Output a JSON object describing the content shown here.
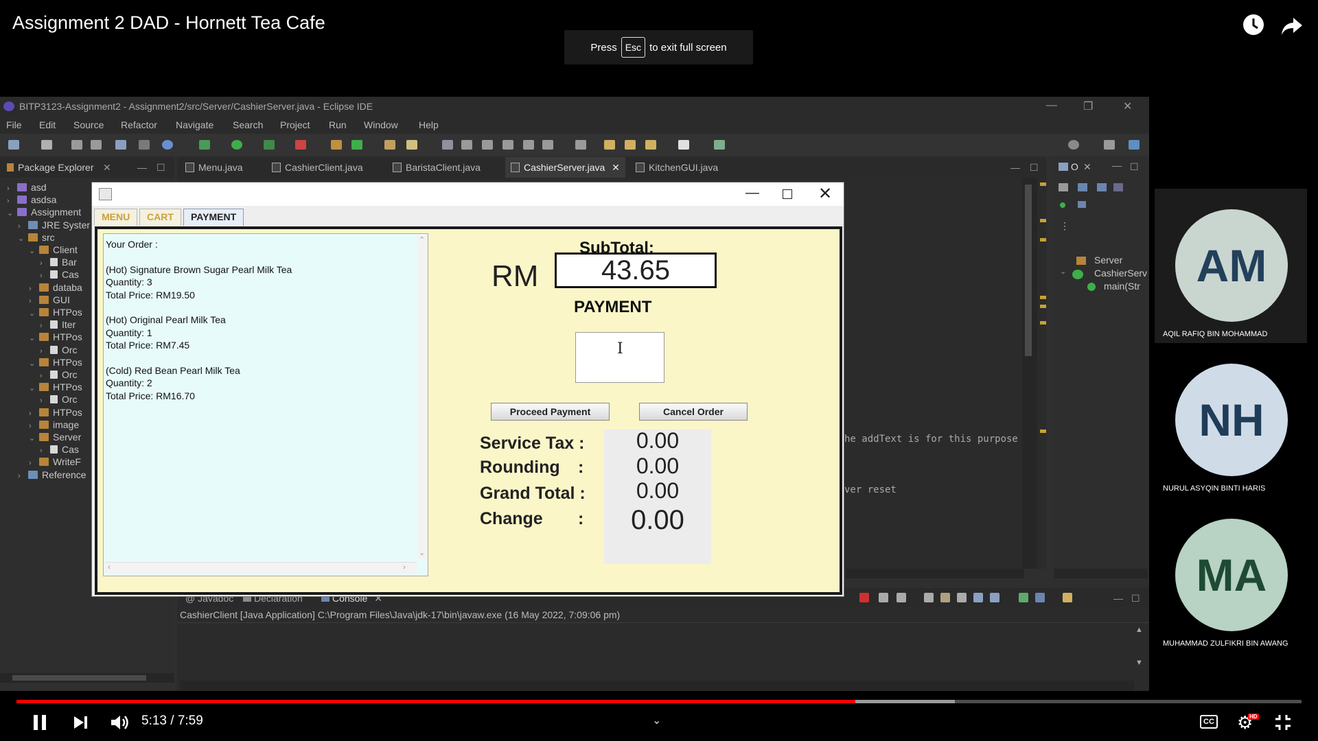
{
  "video": {
    "title": "Assignment 2 DAD - Hornett Tea Cafe",
    "esc_press": "Press",
    "esc_key": "Esc",
    "esc_suffix": "to exit full screen",
    "time": "5:13 / 7:59",
    "progress_fraction": 0.653,
    "buffered_fraction": 0.73,
    "cc_label": "CC",
    "hd_badge": "HD"
  },
  "eclipse": {
    "window_title": "BITP3123-Assignment2 - Assignment2/src/Server/CashierServer.java - Eclipse IDE",
    "menu": [
      "File",
      "Edit",
      "Source",
      "Refactor",
      "Navigate",
      "Search",
      "Project",
      "Run",
      "Window",
      "Help"
    ],
    "package_explorer_tab": "Package Explorer",
    "editor_tabs": [
      "Menu.java",
      "CashierClient.java",
      "BaristaClient.java",
      "CashierServer.java",
      "KitchenGUI.java"
    ],
    "active_editor_tab": "CashierServer.java",
    "tree": [
      {
        "label": "asd",
        "arrow": "›",
        "icon": "proj"
      },
      {
        "label": "asdsa",
        "arrow": "›",
        "icon": "proj"
      },
      {
        "label": "Assignment",
        "arrow": "⌄",
        "icon": "proj"
      },
      {
        "label": "JRE Syster",
        "arrow": "›",
        "icon": "lib"
      },
      {
        "label": "src",
        "arrow": "⌄",
        "icon": "pkg"
      },
      {
        "label": "Client",
        "arrow": "⌄",
        "icon": "pkg"
      },
      {
        "label": "Bar",
        "arrow": "›",
        "icon": "file"
      },
      {
        "label": "Cas",
        "arrow": "›",
        "icon": "file"
      },
      {
        "label": "databa",
        "arrow": "›",
        "icon": "pkg"
      },
      {
        "label": "GUI",
        "arrow": "›",
        "icon": "pkg"
      },
      {
        "label": "HTPos",
        "arrow": "⌄",
        "icon": "pkg"
      },
      {
        "label": "Iter",
        "arrow": "›",
        "icon": "file"
      },
      {
        "label": "HTPos",
        "arrow": "⌄",
        "icon": "pkg"
      },
      {
        "label": "Orc",
        "arrow": "›",
        "icon": "file"
      },
      {
        "label": "HTPos",
        "arrow": "⌄",
        "icon": "pkg"
      },
      {
        "label": "Orc",
        "arrow": "›",
        "icon": "file"
      },
      {
        "label": "HTPos",
        "arrow": "⌄",
        "icon": "pkg"
      },
      {
        "label": "Orc",
        "arrow": "›",
        "icon": "file"
      },
      {
        "label": "HTPos",
        "arrow": "›",
        "icon": "pkg"
      },
      {
        "label": "image",
        "arrow": "›",
        "icon": "pkg"
      },
      {
        "label": "Server",
        "arrow": "⌄",
        "icon": "pkg"
      },
      {
        "label": "Cas",
        "arrow": "›",
        "icon": "file"
      },
      {
        "label": "WriteF",
        "arrow": "›",
        "icon": "pkg"
      },
      {
        "label": "Reference",
        "arrow": "›",
        "icon": "lib"
      }
    ],
    "code_lines": [
      "he addText is for this purpose",
      "ver reset"
    ],
    "outline_tab": "O",
    "outline_items": [
      "Server",
      "CashierServ",
      "main(Str"
    ],
    "console_tabs": [
      "Javadoc",
      "Declaration",
      "Console"
    ],
    "console_info": "CashierClient [Java Application] C:\\Program Files\\Java\\jdk-17\\bin\\javaw.exe  (16 May 2022, 7:09:06 pm)"
  },
  "app": {
    "tabs": [
      "MENU",
      "CART",
      "PAYMENT"
    ],
    "active_tab": "PAYMENT",
    "order_text": "Your Order :\n\n(Hot) Signature Brown Sugar Pearl Milk Tea\nQuantity: 3\nTotal Price: RM19.50\n\n(Hot) Original Pearl Milk Tea\nQuantity: 1\nTotal Price: RM7.45\n\n(Cold) Red Bean Pearl Milk Tea\nQuantity: 2\nTotal Price: RM16.70",
    "subtotal_label": "SubTotal:",
    "currency": "RM",
    "subtotal_value": "43.65",
    "payment_label": "PAYMENT",
    "payment_value": "",
    "proceed_label": "Proceed Payment",
    "cancel_label": "Cancel Order",
    "totals": [
      {
        "label": "Service Tax :",
        "value": "0.00"
      },
      {
        "label": "Rounding",
        "value": "0.00"
      },
      {
        "label": "Grand Total :",
        "value": "0.00"
      },
      {
        "label": "Change",
        "value": "0.00"
      }
    ],
    "colon": ":"
  },
  "participants": [
    {
      "initials": "AM",
      "name": "AQIL RAFIQ BIN MOHAMMAD",
      "color": "#c9d6d0"
    },
    {
      "initials": "NH",
      "name": "NURUL ASYQIN BINTI HARIS",
      "color": "#cfdce8"
    },
    {
      "initials": "MA",
      "name": "MUHAMMAD ZULFIKRI BIN AWANG",
      "color": "#b8d2c3"
    }
  ]
}
